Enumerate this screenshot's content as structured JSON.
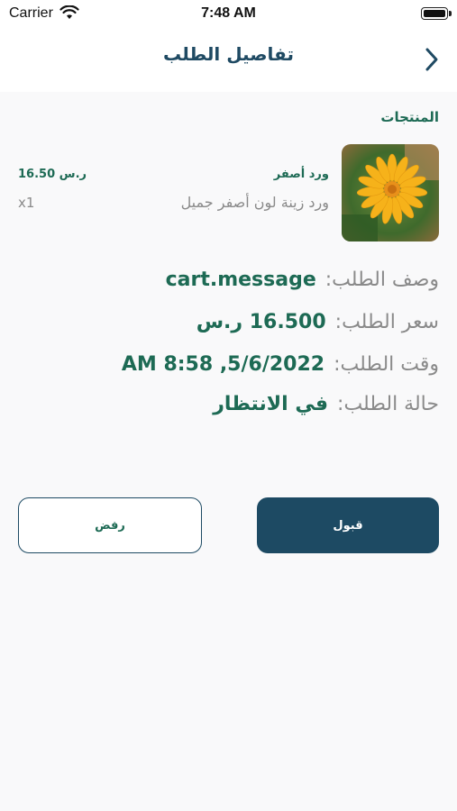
{
  "status_bar": {
    "carrier": "Carrier",
    "time": "7:48 AM"
  },
  "nav": {
    "title": "تفاصيل الطلب",
    "back_icon": "chevron-back-icon"
  },
  "products_section": {
    "label": "المنتجات",
    "items": [
      {
        "name": "ورد أصفر",
        "description": "ورد زينة لون أصفر جميل",
        "price": "16.50 ر.س",
        "quantity": "x1",
        "image_icon": "yellow-flower-photo"
      }
    ]
  },
  "order_info": {
    "description_label": "وصف الطلب:",
    "description_value": "cart.message",
    "price_label": "سعر الطلب:",
    "price_value": "16.500 ر.س",
    "time_label": "وقت الطلب:",
    "time_value": "AM 8:58 ,5/6/2022",
    "status_label": "حالة الطلب:",
    "status_value": "في الانتظار"
  },
  "actions": {
    "accept_label": "قبول",
    "reject_label": "رفض"
  },
  "colors": {
    "primary": "#1d4a63",
    "accent_green": "#1d6a54",
    "muted": "#8a8a8a",
    "background": "#f9f9fa"
  }
}
